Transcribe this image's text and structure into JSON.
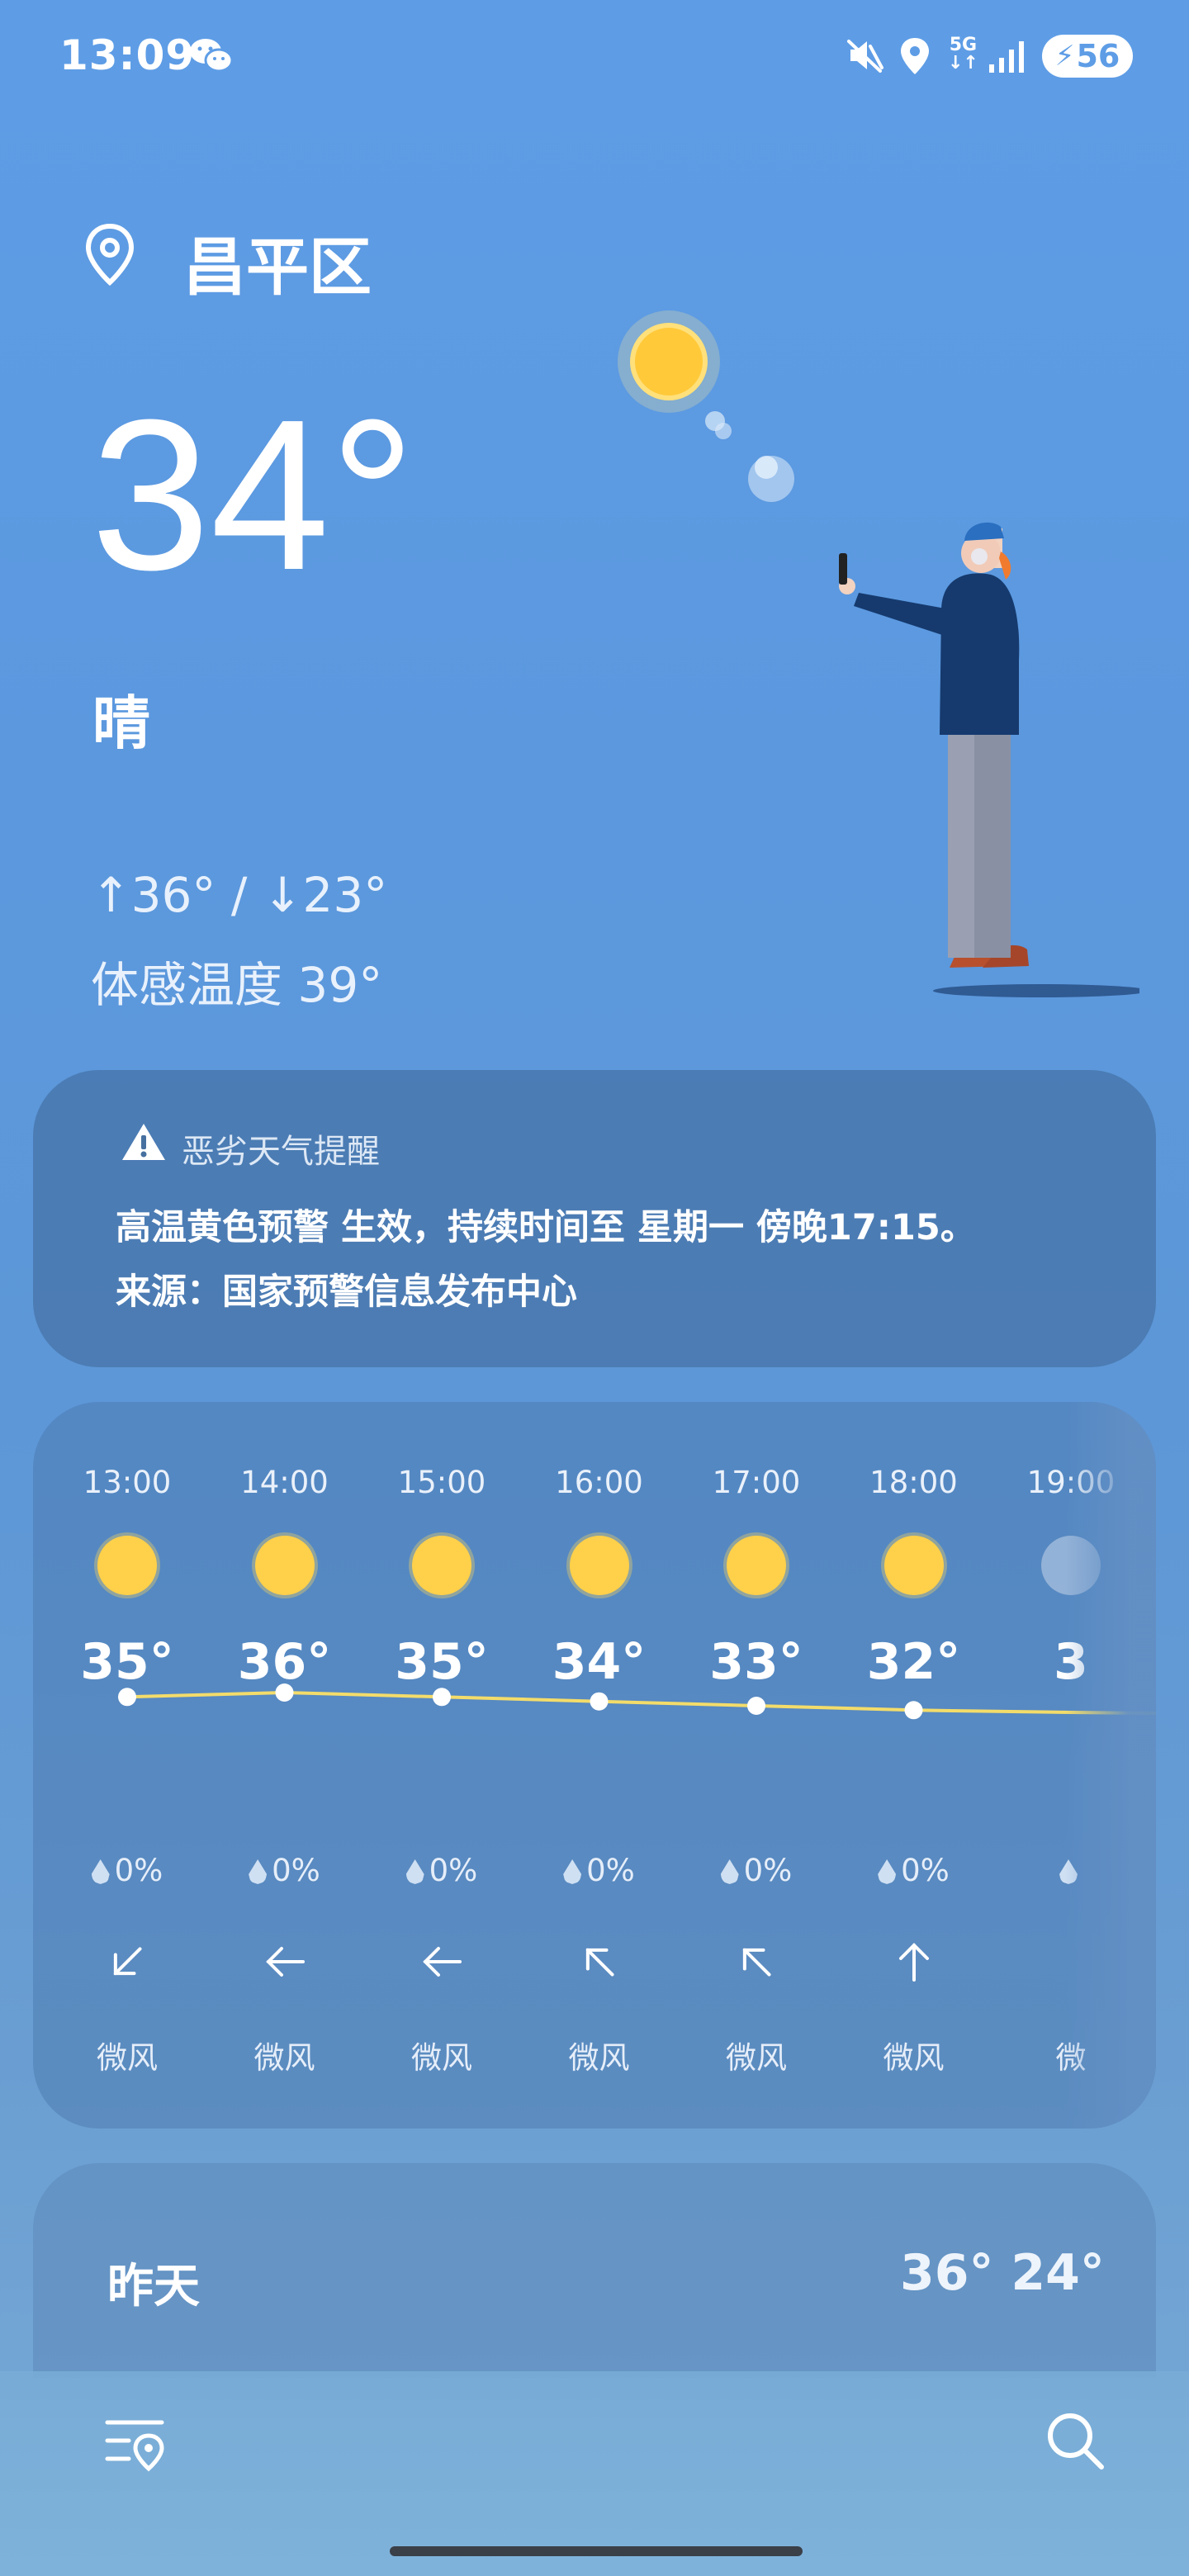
{
  "status_bar": {
    "time": "13:09",
    "network": "5G",
    "battery": "56"
  },
  "location": {
    "name": "昌平区"
  },
  "current": {
    "temperature": "34°",
    "condition": "晴",
    "high_low": "↑36° / ↓23°",
    "feels_like": "体感温度 39°"
  },
  "alert": {
    "title": "恶劣天气提醒",
    "line1": "高温黄色预警 生效，持续时间至 星期一 傍晚17:15。",
    "line2": "来源：国家预警信息发布中心"
  },
  "hourly": [
    {
      "time": "13:00",
      "temp": "35°",
      "precip": "0%",
      "wind": "微风",
      "wind_dir": "down-left"
    },
    {
      "time": "14:00",
      "temp": "36°",
      "precip": "0%",
      "wind": "微风",
      "wind_dir": "left"
    },
    {
      "time": "15:00",
      "temp": "35°",
      "precip": "0%",
      "wind": "微风",
      "wind_dir": "left"
    },
    {
      "time": "16:00",
      "temp": "34°",
      "precip": "0%",
      "wind": "微风",
      "wind_dir": "up-left"
    },
    {
      "time": "17:00",
      "temp": "33°",
      "precip": "0%",
      "wind": "微风",
      "wind_dir": "up-left"
    },
    {
      "time": "18:00",
      "temp": "32°",
      "precip": "0%",
      "wind": "微风",
      "wind_dir": "up"
    },
    {
      "time": "19:00",
      "temp": "3",
      "precip": "",
      "wind": "微",
      "wind_dir": ""
    }
  ],
  "yesterday": {
    "label": "昨天",
    "temps": "36° 24°"
  },
  "colors": {
    "sun": "#ffd04a",
    "temp_line": "#f3dc6a",
    "background": "#5e9de6"
  }
}
